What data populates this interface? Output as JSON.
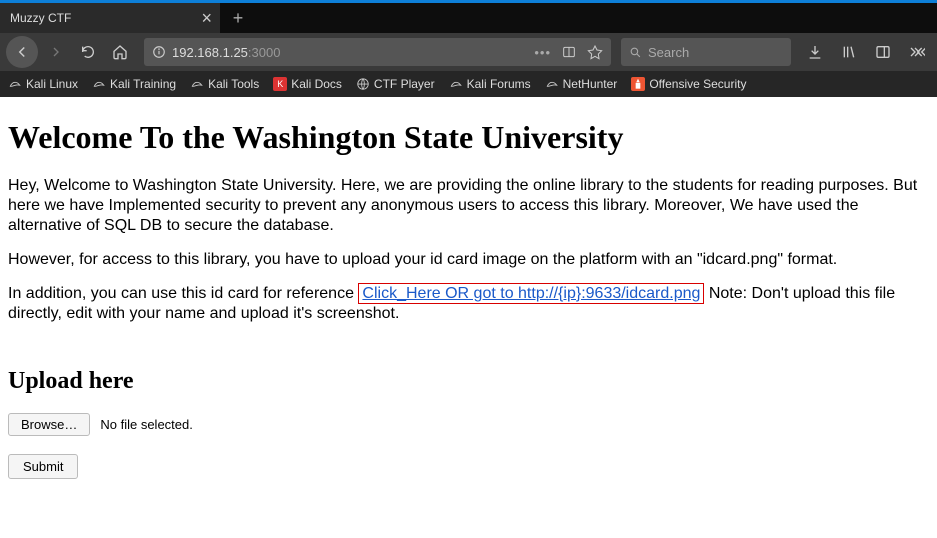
{
  "tab": {
    "title": "Muzzy CTF"
  },
  "urlbar": {
    "host": "192.168.1.25",
    "port": ":3000"
  },
  "searchbar": {
    "placeholder": "Search"
  },
  "bookmarks": [
    {
      "label": "Kali Linux"
    },
    {
      "label": "Kali Training"
    },
    {
      "label": "Kali Tools"
    },
    {
      "label": "Kali Docs"
    },
    {
      "label": "CTF Player"
    },
    {
      "label": "Kali Forums"
    },
    {
      "label": "NetHunter"
    },
    {
      "label": "Offensive Security"
    }
  ],
  "page": {
    "heading": "Welcome To the Washington State University",
    "para1": "Hey, Welcome to Washington State University. Here, we are providing the online library to the students for reading purposes. But here we have Implemented security to prevent any anonymous users to access this library. Moreover, We have used the alternative of SQL DB to secure the database.",
    "para2": "However, for access to this library, you have to upload your id card image on the platform with an \"idcard.png\" format.",
    "para3_prefix": "In addition, you can use this id card for reference ",
    "para3_link": "Click_Here OR got to http://{ip}:9633/idcard.png",
    "para3_suffix": " Note: Don't upload this file directly, edit with your name and upload it's screenshot.",
    "upload_heading": "Upload here",
    "browse_label": "Browse…",
    "no_file": "No file selected.",
    "submit_label": "Submit"
  }
}
